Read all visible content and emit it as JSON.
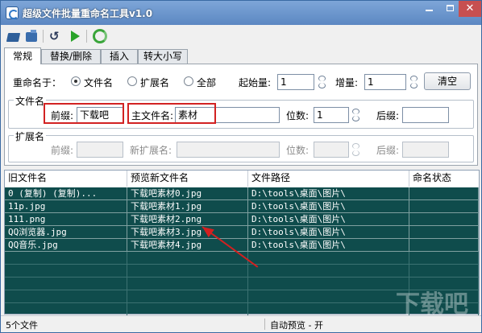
{
  "window": {
    "title": "超级文件批量重命名工具v1.0"
  },
  "toolbar": {
    "undo_glyph": "↺"
  },
  "tabs": [
    "常规",
    "替换/删除",
    "插入",
    "转大小写"
  ],
  "rename": {
    "label": "重命名于：",
    "options": [
      "文件名",
      "扩展名",
      "全部"
    ],
    "selected": "文件名",
    "start_label": "起始量:",
    "start_value": "1",
    "increment_label": "增量:",
    "increment_value": "1",
    "clear_button": "清空"
  },
  "filename_group": {
    "title": "文件名",
    "prefix_label": "前缀:",
    "prefix_value": "下载吧",
    "main_label": "主文件名:",
    "main_value": "素材",
    "digits_label": "位数:",
    "digits_value": "1",
    "suffix_label": "后缀:",
    "suffix_value": ""
  },
  "ext_group": {
    "title": "扩展名",
    "prefix_label": "前缀:",
    "new_ext_label": "新扩展名:",
    "digits_label": "位数:",
    "suffix_label": "后缀:"
  },
  "list": {
    "columns": [
      "旧文件名",
      "预览新文件名",
      "文件路径",
      "命名状态"
    ],
    "rows": [
      {
        "old": "0 (复制) (复制)...",
        "new": "下载吧素材0.jpg",
        "path": "D:\\tools\\桌面\\图片\\",
        "status": ""
      },
      {
        "old": "11p.jpg",
        "new": "下载吧素材1.jpg",
        "path": "D:\\tools\\桌面\\图片\\",
        "status": ""
      },
      {
        "old": "111.png",
        "new": "下载吧素材2.png",
        "path": "D:\\tools\\桌面\\图片\\",
        "status": ""
      },
      {
        "old": "QQ浏览器.jpg",
        "new": "下载吧素材3.jpg",
        "path": "D:\\tools\\桌面\\图片\\",
        "status": ""
      },
      {
        "old": "QQ音乐.jpg",
        "new": "下载吧素材4.jpg",
        "path": "D:\\tools\\桌面\\图片\\",
        "status": ""
      }
    ]
  },
  "status": {
    "count": "5个文件",
    "preview": "自动预览 - 开"
  },
  "watermark": {
    "text": "下载吧"
  }
}
